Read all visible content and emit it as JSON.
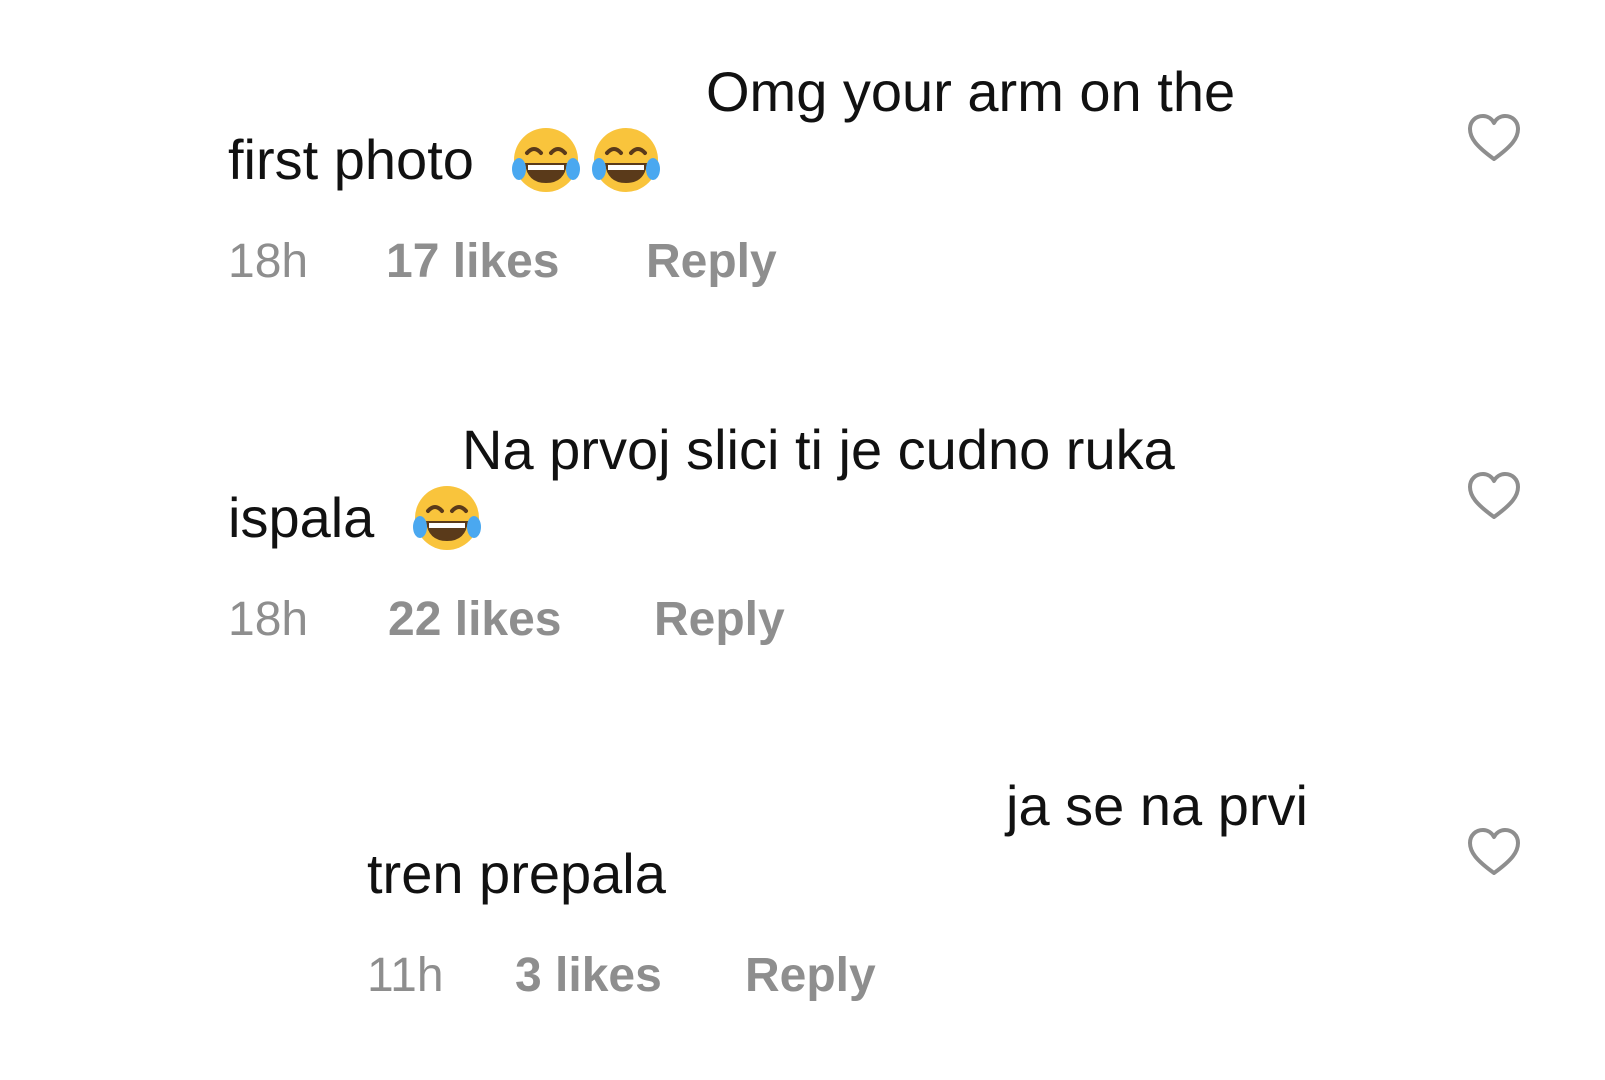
{
  "comments": [
    {
      "line1": "Omg your arm on the",
      "line2": "first photo",
      "emoji_count": 2,
      "emoji": "face-with-tears-of-joy",
      "time": "18h",
      "likes": "17 likes",
      "reply": "Reply"
    },
    {
      "line1": "Na prvoj slici ti je cudno ruka",
      "line2": "ispala",
      "emoji_count": 1,
      "emoji": "face-with-tears-of-joy",
      "time": "18h",
      "likes": "22 likes",
      "reply": "Reply"
    },
    {
      "line1": "ja se na prvi",
      "line2": "tren prepala",
      "emoji_count": 0,
      "time": "11h",
      "likes": "3 likes",
      "reply": "Reply"
    }
  ],
  "icons": {
    "like": "heart-outline-icon"
  },
  "colors": {
    "text": "#111111",
    "meta": "#8e8e8e",
    "heart": "#8e8e8e",
    "emoji_face": "#f9c43c",
    "emoji_tears": "#4aa8f0"
  }
}
